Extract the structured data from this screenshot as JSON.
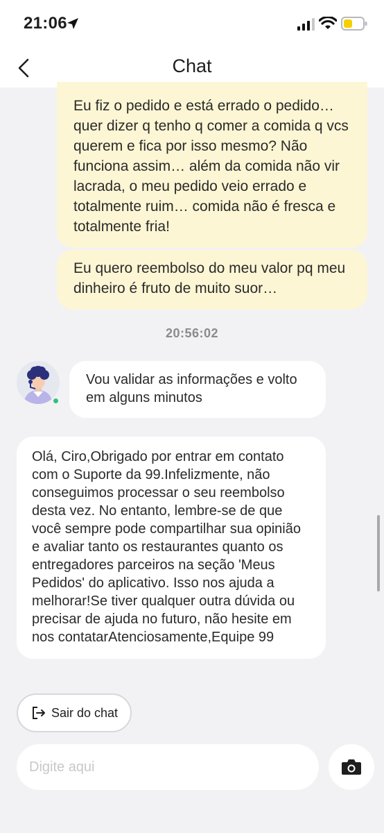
{
  "status_bar": {
    "time": "21:06"
  },
  "header": {
    "title": "Chat"
  },
  "messages": {
    "user_1": "Eu fiz o pedido e está errado o pedido… quer dizer q tenho q comer a comida q vcs querem e fica por isso mesmo? Não funciona assim… além da comida não vir lacrada, o meu pedido veio errado e totalmente ruim… comida não é fresca e totalmente fria!",
    "user_2": "Eu quero reembolso do meu valor pq meu dinheiro é fruto de muito suor…",
    "timestamp": "20:56:02",
    "agent_1": "Vou validar as informações e volto em alguns minutos",
    "agent_2": "Olá, Ciro,Obrigado por entrar em contato com o Suporte da 99.Infelizmente, não conseguimos processar o seu reembolso desta vez. No entanto, lembre-se de que você sempre pode compartilhar sua opinião e avaliar tanto os restaurantes quanto os entregadores parceiros na seção 'Meus Pedidos' do aplicativo. Isso nos ajuda a melhorar!Se tiver qualquer outra dúvida ou precisar de ajuda no futuro, não hesite em nos contatarAtenciosamente,Equipe 99"
  },
  "actions": {
    "exit_chat_label": "Sair do chat"
  },
  "composer": {
    "placeholder": "Digite aqui"
  },
  "colors": {
    "user_bubble": "#fdf6d4",
    "agent_bubble": "#ffffff",
    "background": "#f2f2f4",
    "battery_fill": "#f5d000",
    "online": "#2ec27e"
  },
  "icons": {
    "back": "chevron-left-icon",
    "location": "location-arrow-icon",
    "signal": "cellular-signal-icon",
    "wifi": "wifi-icon",
    "battery": "battery-icon",
    "exit": "logout-icon",
    "camera": "camera-icon"
  }
}
